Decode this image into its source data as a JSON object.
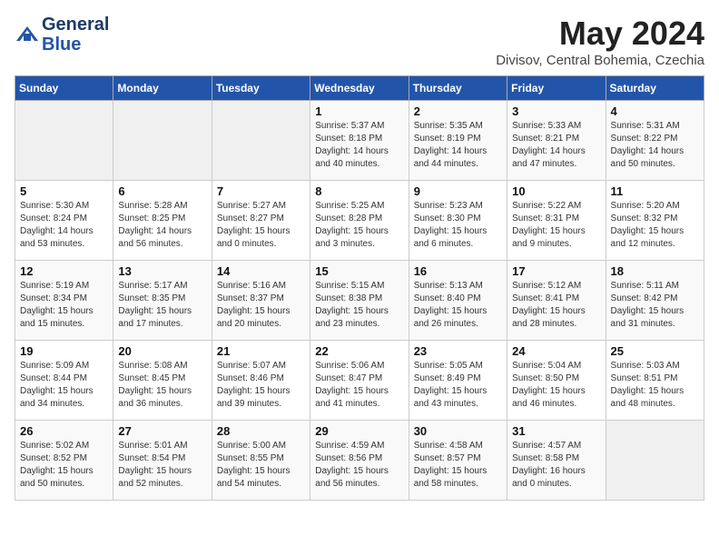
{
  "header": {
    "logo_line1": "General",
    "logo_line2": "Blue",
    "month_year": "May 2024",
    "location": "Divisov, Central Bohemia, Czechia"
  },
  "weekdays": [
    "Sunday",
    "Monday",
    "Tuesday",
    "Wednesday",
    "Thursday",
    "Friday",
    "Saturday"
  ],
  "weeks": [
    [
      {
        "day": "",
        "info": ""
      },
      {
        "day": "",
        "info": ""
      },
      {
        "day": "",
        "info": ""
      },
      {
        "day": "1",
        "info": "Sunrise: 5:37 AM\nSunset: 8:18 PM\nDaylight: 14 hours\nand 40 minutes."
      },
      {
        "day": "2",
        "info": "Sunrise: 5:35 AM\nSunset: 8:19 PM\nDaylight: 14 hours\nand 44 minutes."
      },
      {
        "day": "3",
        "info": "Sunrise: 5:33 AM\nSunset: 8:21 PM\nDaylight: 14 hours\nand 47 minutes."
      },
      {
        "day": "4",
        "info": "Sunrise: 5:31 AM\nSunset: 8:22 PM\nDaylight: 14 hours\nand 50 minutes."
      }
    ],
    [
      {
        "day": "5",
        "info": "Sunrise: 5:30 AM\nSunset: 8:24 PM\nDaylight: 14 hours\nand 53 minutes."
      },
      {
        "day": "6",
        "info": "Sunrise: 5:28 AM\nSunset: 8:25 PM\nDaylight: 14 hours\nand 56 minutes."
      },
      {
        "day": "7",
        "info": "Sunrise: 5:27 AM\nSunset: 8:27 PM\nDaylight: 15 hours\nand 0 minutes."
      },
      {
        "day": "8",
        "info": "Sunrise: 5:25 AM\nSunset: 8:28 PM\nDaylight: 15 hours\nand 3 minutes."
      },
      {
        "day": "9",
        "info": "Sunrise: 5:23 AM\nSunset: 8:30 PM\nDaylight: 15 hours\nand 6 minutes."
      },
      {
        "day": "10",
        "info": "Sunrise: 5:22 AM\nSunset: 8:31 PM\nDaylight: 15 hours\nand 9 minutes."
      },
      {
        "day": "11",
        "info": "Sunrise: 5:20 AM\nSunset: 8:32 PM\nDaylight: 15 hours\nand 12 minutes."
      }
    ],
    [
      {
        "day": "12",
        "info": "Sunrise: 5:19 AM\nSunset: 8:34 PM\nDaylight: 15 hours\nand 15 minutes."
      },
      {
        "day": "13",
        "info": "Sunrise: 5:17 AM\nSunset: 8:35 PM\nDaylight: 15 hours\nand 17 minutes."
      },
      {
        "day": "14",
        "info": "Sunrise: 5:16 AM\nSunset: 8:37 PM\nDaylight: 15 hours\nand 20 minutes."
      },
      {
        "day": "15",
        "info": "Sunrise: 5:15 AM\nSunset: 8:38 PM\nDaylight: 15 hours\nand 23 minutes."
      },
      {
        "day": "16",
        "info": "Sunrise: 5:13 AM\nSunset: 8:40 PM\nDaylight: 15 hours\nand 26 minutes."
      },
      {
        "day": "17",
        "info": "Sunrise: 5:12 AM\nSunset: 8:41 PM\nDaylight: 15 hours\nand 28 minutes."
      },
      {
        "day": "18",
        "info": "Sunrise: 5:11 AM\nSunset: 8:42 PM\nDaylight: 15 hours\nand 31 minutes."
      }
    ],
    [
      {
        "day": "19",
        "info": "Sunrise: 5:09 AM\nSunset: 8:44 PM\nDaylight: 15 hours\nand 34 minutes."
      },
      {
        "day": "20",
        "info": "Sunrise: 5:08 AM\nSunset: 8:45 PM\nDaylight: 15 hours\nand 36 minutes."
      },
      {
        "day": "21",
        "info": "Sunrise: 5:07 AM\nSunset: 8:46 PM\nDaylight: 15 hours\nand 39 minutes."
      },
      {
        "day": "22",
        "info": "Sunrise: 5:06 AM\nSunset: 8:47 PM\nDaylight: 15 hours\nand 41 minutes."
      },
      {
        "day": "23",
        "info": "Sunrise: 5:05 AM\nSunset: 8:49 PM\nDaylight: 15 hours\nand 43 minutes."
      },
      {
        "day": "24",
        "info": "Sunrise: 5:04 AM\nSunset: 8:50 PM\nDaylight: 15 hours\nand 46 minutes."
      },
      {
        "day": "25",
        "info": "Sunrise: 5:03 AM\nSunset: 8:51 PM\nDaylight: 15 hours\nand 48 minutes."
      }
    ],
    [
      {
        "day": "26",
        "info": "Sunrise: 5:02 AM\nSunset: 8:52 PM\nDaylight: 15 hours\nand 50 minutes."
      },
      {
        "day": "27",
        "info": "Sunrise: 5:01 AM\nSunset: 8:54 PM\nDaylight: 15 hours\nand 52 minutes."
      },
      {
        "day": "28",
        "info": "Sunrise: 5:00 AM\nSunset: 8:55 PM\nDaylight: 15 hours\nand 54 minutes."
      },
      {
        "day": "29",
        "info": "Sunrise: 4:59 AM\nSunset: 8:56 PM\nDaylight: 15 hours\nand 56 minutes."
      },
      {
        "day": "30",
        "info": "Sunrise: 4:58 AM\nSunset: 8:57 PM\nDaylight: 15 hours\nand 58 minutes."
      },
      {
        "day": "31",
        "info": "Sunrise: 4:57 AM\nSunset: 8:58 PM\nDaylight: 16 hours\nand 0 minutes."
      },
      {
        "day": "",
        "info": ""
      }
    ]
  ]
}
